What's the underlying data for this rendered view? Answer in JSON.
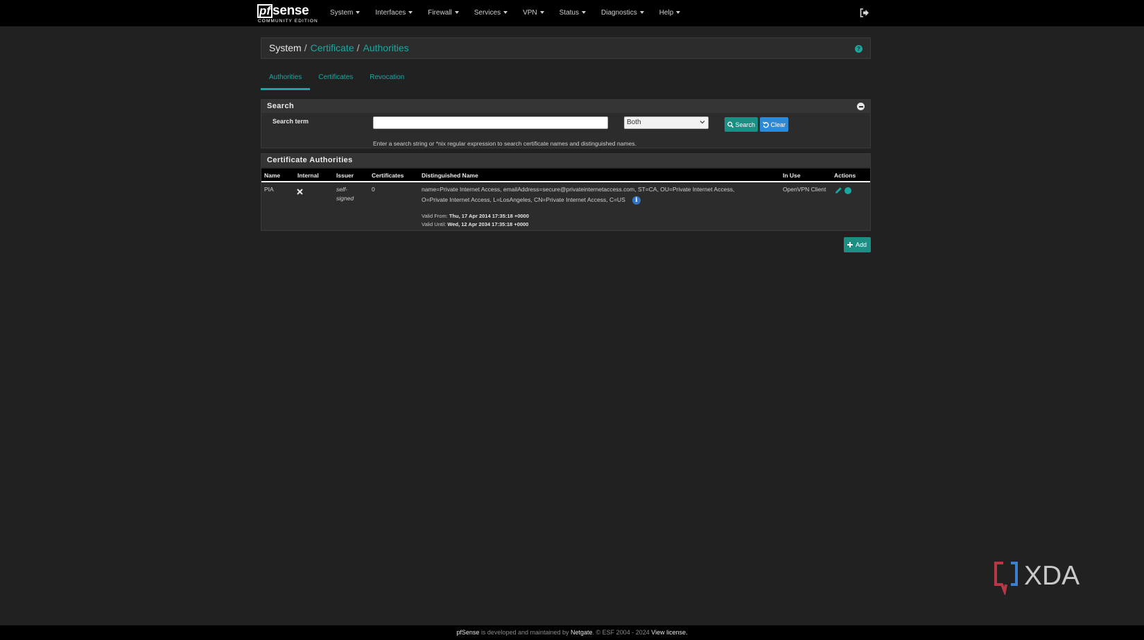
{
  "brand": {
    "pf": "pf",
    "sense": "sense",
    "edition": "COMMUNITY EDITION"
  },
  "nav": {
    "items": [
      {
        "label": "System"
      },
      {
        "label": "Interfaces"
      },
      {
        "label": "Firewall"
      },
      {
        "label": "Services"
      },
      {
        "label": "VPN"
      },
      {
        "label": "Status"
      },
      {
        "label": "Diagnostics"
      },
      {
        "label": "Help"
      }
    ]
  },
  "breadcrumb": {
    "root": "System",
    "sep1": "/",
    "link1": "Certificate",
    "sep2": "/",
    "link2": "Authorities"
  },
  "tabs": [
    "Authorities",
    "Certificates",
    "Revocation"
  ],
  "search": {
    "title": "Search",
    "label": "Search term",
    "value": "",
    "placeholder": "",
    "select_value": "Both",
    "search_button": "Search",
    "clear_button": "Clear",
    "help_text": "Enter a search string or *nix regular expression to search certificate names and distinguished names."
  },
  "ca": {
    "title": "Certificate Authorities",
    "columns": [
      "Name",
      "Internal",
      "Issuer",
      "Certificates",
      "Distinguished Name",
      "In Use",
      "Actions"
    ],
    "rows": [
      {
        "name": "PIA",
        "issuer_line1": "self-",
        "issuer_line2": "signed",
        "certificates": "0",
        "dn_line1": "name=Private Internet Access, emailAddress=secure@privateinternetaccess.com, ST=CA, OU=Private Internet Access,",
        "dn_line2": "O=Private Internet Access, L=LosAngeles, CN=Private Internet Access, C=US",
        "valid_from_label": "Valid From:",
        "valid_from": "Thu, 17 Apr 2014 17:35:18 +0000",
        "valid_until_label": "Valid Until:",
        "valid_until": "Wed, 12 Apr 2034 17:35:18 +0000",
        "in_use": "OpenVPN Client"
      }
    ],
    "add_button": "Add"
  },
  "watermark": "XDA",
  "footer": {
    "product": "pfSense",
    "mid": " is developed and maintained by ",
    "company": "Netgate",
    "copy": ". © ESF 2004 - 2024 ",
    "license": "View license."
  },
  "colors": {
    "accent": "#17a8a0",
    "background": "#212121",
    "panel": "#2c2c2c",
    "clear_button": "#2d8ad8",
    "info_icon": "#3574c4"
  }
}
